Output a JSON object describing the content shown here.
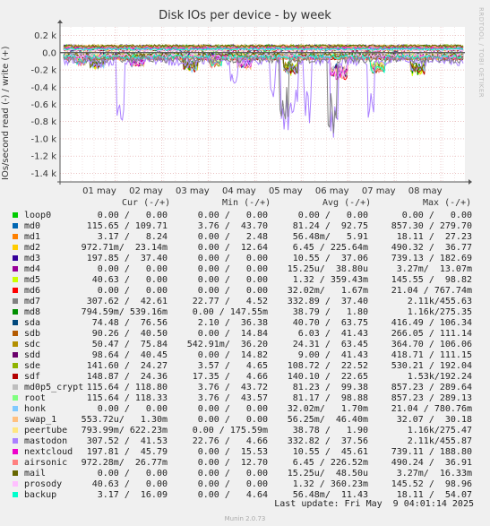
{
  "title": "Disk IOs per device - by week",
  "ylabel": "IOs/second read (-) / write (+)",
  "side_text": "RRDTOOL / TOBI OETIKER",
  "chart_data": {
    "type": "line",
    "y_ticks": [
      0.2,
      0.0,
      -0.2,
      -0.4,
      -0.6,
      -0.8,
      -1.0,
      -1.2,
      -1.4
    ],
    "y_tick_labels": [
      "0.2 k",
      "0.0",
      "-0.2 k",
      "-0.4 k",
      "-0.6 k",
      "-0.8 k",
      "-1.0 k",
      "-1.2 k",
      "-1.4 k"
    ],
    "ylim": [
      -1.5,
      0.3
    ],
    "x_ticks": [
      "01 may",
      "02 may",
      "03 may",
      "04 may",
      "05 may",
      "06 may",
      "07 may",
      "08 may"
    ],
    "unit": "k",
    "grid": true
  },
  "legend": {
    "headers": {
      "cur": "Cur (-/+)",
      "min": "Min (-/+)",
      "avg": "Avg (-/+)",
      "max": "Max (-/+)"
    },
    "rows": [
      {
        "name": "loop0",
        "color": "#00cc00",
        "cur": "0.00 /   0.00",
        "min": "0.00 /   0.00",
        "avg": "0.00 /   0.00",
        "max": "0.00 /   0.00"
      },
      {
        "name": "md0",
        "color": "#0066b3",
        "cur": "115.65 / 109.71",
        "min": "3.76 /  43.70",
        "avg": "81.24 /  92.75",
        "max": "857.30 / 279.70"
      },
      {
        "name": "md1",
        "color": "#ff8000",
        "cur": "3.17 /   8.24",
        "min": "0.00 /   2.48",
        "avg": "56.48m/   5.91",
        "max": "18.11 /  27.23"
      },
      {
        "name": "md2",
        "color": "#ffcc00",
        "cur": "972.71m/  23.14m",
        "min": "0.00 /  12.64",
        "avg": "6.45 / 225.64m",
        "max": "490.32 /  36.77"
      },
      {
        "name": "md3",
        "color": "#330099",
        "cur": "197.85 /  37.40",
        "min": "0.00 /   0.00",
        "avg": "10.55 /  37.06",
        "max": "739.13 / 182.69"
      },
      {
        "name": "md4",
        "color": "#990099",
        "cur": "0.00 /   0.00",
        "min": "0.00 /   0.00",
        "avg": "15.25u/  38.80u",
        "max": "3.27m/  13.07m"
      },
      {
        "name": "md5",
        "color": "#ccff00",
        "cur": "40.63 /   0.00",
        "min": "0.00 /   0.00",
        "avg": "1.32 / 359.43m",
        "max": "145.55 /  98.82"
      },
      {
        "name": "md6",
        "color": "#ff0000",
        "cur": "0.00 /   0.00",
        "min": "0.00 /   0.00",
        "avg": "32.02m/   1.67m",
        "max": "21.04 / 767.74m"
      },
      {
        "name": "md7",
        "color": "#808080",
        "cur": "307.62 /  42.61",
        "min": "22.77 /   4.52",
        "avg": "332.89 /  37.40",
        "max": "2.11k/455.63"
      },
      {
        "name": "md8",
        "color": "#008f00",
        "cur": "794.59m/ 539.16m",
        "min": "0.00 / 147.55m",
        "avg": "38.79 /   1.80",
        "max": "1.16k/275.35"
      },
      {
        "name": "sda",
        "color": "#00487d",
        "cur": "74.48 /  76.56",
        "min": "2.10 /  36.38",
        "avg": "40.70 /  63.75",
        "max": "416.49 / 106.34"
      },
      {
        "name": "sdb",
        "color": "#b35a00",
        "cur": "90.26 /  40.50",
        "min": "0.00 /  14.84",
        "avg": "6.03 /  41.43",
        "max": "266.05 / 111.14"
      },
      {
        "name": "sdc",
        "color": "#b38f00",
        "cur": "50.47 /  75.84",
        "min": "542.91m/  36.20",
        "avg": "24.31 /  63.45",
        "max": "364.70 / 106.06"
      },
      {
        "name": "sdd",
        "color": "#6b006b",
        "cur": "98.64 /  40.45",
        "min": "0.00 /  14.82",
        "avg": "9.00 /  41.43",
        "max": "418.71 / 111.15"
      },
      {
        "name": "sde",
        "color": "#8fb300",
        "cur": "141.60 /  24.27",
        "min": "3.57 /   4.65",
        "avg": "108.72 /  22.52",
        "max": "530.21 / 192.04"
      },
      {
        "name": "sdf",
        "color": "#b30000",
        "cur": "148.87 /  24.36",
        "min": "17.35 /   4.66",
        "avg": "140.10 /  22.65",
        "max": "1.53k/192.24"
      },
      {
        "name": "md0p5_crypt",
        "color": "#bebebe",
        "cur": "115.64 / 118.80",
        "min": "3.76 /  43.72",
        "avg": "81.23 /  99.38",
        "max": "857.23 / 289.64"
      },
      {
        "name": "root",
        "color": "#80ff80",
        "cur": "115.64 / 118.33",
        "min": "3.76 /  43.57",
        "avg": "81.17 /  98.88",
        "max": "857.23 / 289.13"
      },
      {
        "name": "honk",
        "color": "#80c9ff",
        "cur": "0.00 /   0.00",
        "min": "0.00 /   0.00",
        "avg": "32.02m/   1.70m",
        "max": "21.04 / 780.76m"
      },
      {
        "name": "swap_1",
        "color": "#ffc080",
        "cur": "553.72u/   1.30m",
        "min": "0.00 /   0.00",
        "avg": "56.25m/  46.40m",
        "max": "32.07 /  30.18"
      },
      {
        "name": "peertube",
        "color": "#ffe680",
        "cur": "793.99m/ 622.23m",
        "min": "0.00 / 175.59m",
        "avg": "38.78 /   1.90",
        "max": "1.16k/275.47"
      },
      {
        "name": "mastodon",
        "color": "#aa80ff",
        "cur": "307.52 /  41.53",
        "min": "22.76 /   4.66",
        "avg": "332.82 /  37.56",
        "max": "2.11k/455.87"
      },
      {
        "name": "nextcloud",
        "color": "#ee00cc",
        "cur": "197.81 /  45.79",
        "min": "0.00 /  15.53",
        "avg": "10.55 /  45.61",
        "max": "739.11 / 188.80"
      },
      {
        "name": "airsonic",
        "color": "#ff8080",
        "cur": "972.28m/  26.77m",
        "min": "0.00 /  12.70",
        "avg": "6.45 / 226.52m",
        "max": "490.24 /  36.91"
      },
      {
        "name": "mail",
        "color": "#666600",
        "cur": "0.00 /   0.00",
        "min": "0.00 /   0.00",
        "avg": "15.25u/  48.50u",
        "max": "3.27m/  16.33m"
      },
      {
        "name": "prosody",
        "color": "#ffbfff",
        "cur": "40.63 /   0.00",
        "min": "0.00 /   0.00",
        "avg": "1.32 / 360.23m",
        "max": "145.52 /  98.96"
      },
      {
        "name": "backup",
        "color": "#00ffcc",
        "cur": "3.17 /  16.09",
        "min": "0.00 /   4.64",
        "avg": "56.48m/  11.43",
        "max": "18.11 /  54.07"
      }
    ]
  },
  "footer": {
    "last_update": "Last update: Fri May  9 04:01:14 2025",
    "version": "Munin 2.0.73"
  }
}
